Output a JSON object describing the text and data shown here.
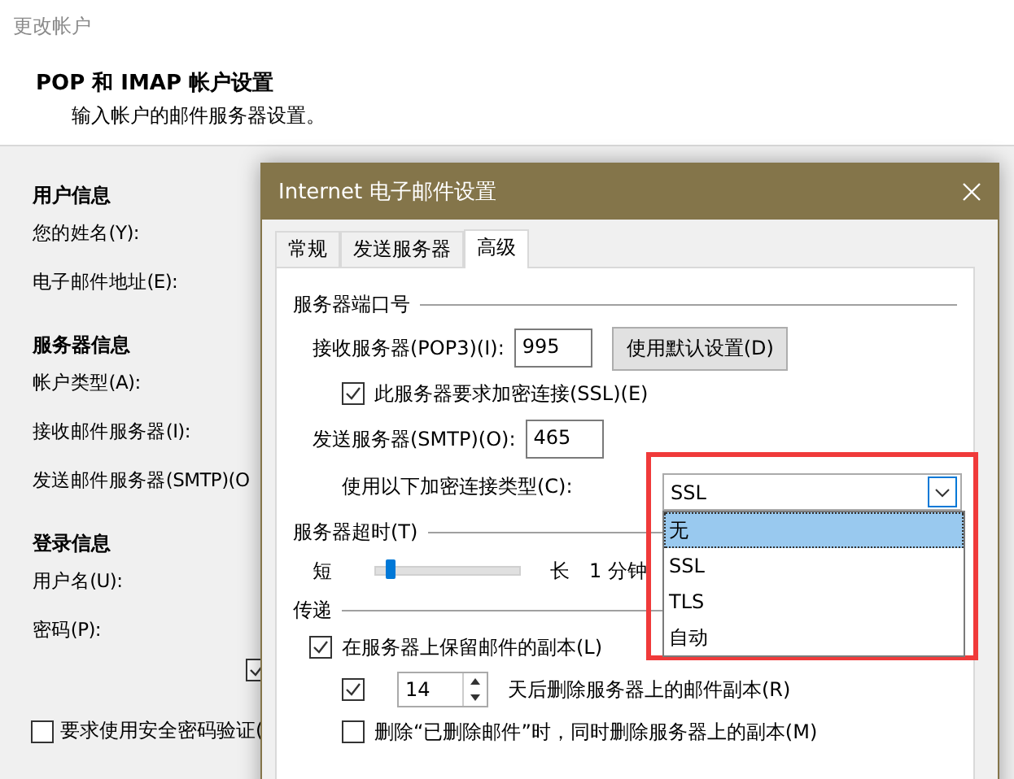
{
  "window": {
    "title": "更改帐户"
  },
  "header": {
    "title": "POP 和 IMAP 帐户设置",
    "subtitle": "输入帐户的邮件服务器设置。"
  },
  "sections": [
    {
      "heading": "用户信息",
      "labels": [
        "您的姓名(Y):",
        "电子邮件地址(E):"
      ]
    },
    {
      "heading": "服务器信息",
      "labels": [
        "帐户类型(A):",
        "接收邮件服务器(I):",
        "发送邮件服务器(SMTP)(O"
      ]
    },
    {
      "heading": "登录信息",
      "labels": [
        "用户名(U):",
        "密码(P):"
      ]
    }
  ],
  "hidden_checkbox": {
    "checked": true
  },
  "spa_checkbox": {
    "label": "要求使用安全密码验证(",
    "checked": false
  },
  "dialog": {
    "title": "Internet 电子邮件设置",
    "tabs": [
      {
        "label": "常规",
        "selected": false
      },
      {
        "label": "发送服务器",
        "selected": false
      },
      {
        "label": "高级",
        "selected": true
      }
    ],
    "ports": {
      "heading": "服务器端口号",
      "incoming_label": "接收服务器(POP3)(I):",
      "incoming_value": "995",
      "default_button": "使用默认设置(D)",
      "ssl": {
        "label": "此服务器要求加密连接(SSL)(E)",
        "checked": true
      },
      "outgoing_label": "发送服务器(SMTP)(O):",
      "outgoing_value": "465",
      "encryption_label": "使用以下加密连接类型(C):",
      "encryption_value": "SSL",
      "options": [
        {
          "label": "无",
          "selected": true
        },
        {
          "label": "SSL",
          "selected": false
        },
        {
          "label": "TLS",
          "selected": false
        },
        {
          "label": "自动",
          "selected": false
        }
      ]
    },
    "timeout": {
      "heading": "服务器超时(T)",
      "short": "短",
      "long": "长",
      "level": 0.1,
      "reading": "1 分钟"
    },
    "delivery": {
      "heading": "传递",
      "keep_copy": {
        "label": "在服务器上保留邮件的副本(L)",
        "checked": true
      },
      "remove_after": {
        "checked": true,
        "days": "14",
        "label": "天后删除服务器上的邮件副本(R)"
      },
      "remove_deleted": {
        "label": "删除“已删除邮件”时，同时删除服务器上的副本(M)",
        "checked": false
      }
    }
  }
}
